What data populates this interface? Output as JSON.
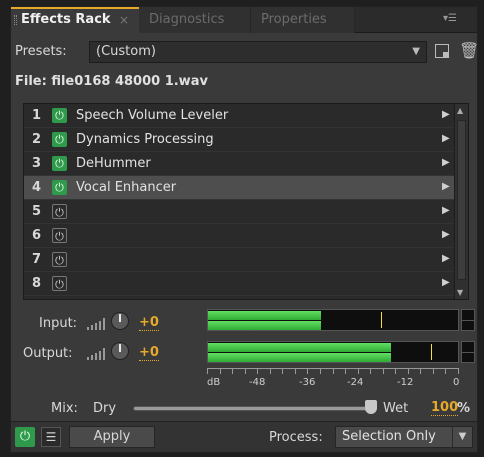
{
  "tabs": [
    {
      "label": "Effects Rack",
      "active": true,
      "close": "×"
    },
    {
      "label": "Diagnostics",
      "active": false
    },
    {
      "label": "Properties",
      "active": false
    }
  ],
  "presets": {
    "label": "Presets:",
    "value": "(Custom)"
  },
  "file": {
    "text": "File: file0168 48000 1.wav"
  },
  "effects": [
    {
      "num": "1",
      "name": "Speech Volume Leveler",
      "power": "on",
      "selected": false
    },
    {
      "num": "2",
      "name": "Dynamics Processing",
      "power": "on",
      "selected": false
    },
    {
      "num": "3",
      "name": "DeHummer",
      "power": "on",
      "selected": false
    },
    {
      "num": "4",
      "name": "Vocal Enhancer",
      "power": "on",
      "selected": true
    },
    {
      "num": "5",
      "name": "",
      "power": "off",
      "selected": false
    },
    {
      "num": "6",
      "name": "",
      "power": "off",
      "selected": false
    },
    {
      "num": "7",
      "name": "",
      "power": "off",
      "selected": false
    },
    {
      "num": "8",
      "name": "",
      "power": "off",
      "selected": false
    }
  ],
  "input": {
    "label": "Input:",
    "value": "+0",
    "level_fraction": 0.45,
    "peak_fraction": 0.69
  },
  "output": {
    "label": "Output:",
    "value": "+0",
    "level_fraction": 0.73,
    "peak_fraction": 0.89
  },
  "scale": {
    "labels": [
      "dB",
      "-48",
      "-36",
      "-24",
      "-12",
      "0"
    ]
  },
  "mix": {
    "label": "Mix:",
    "dry": "Dry",
    "wet": "Wet",
    "value": "100",
    "unit": "%"
  },
  "bottom": {
    "apply": "Apply",
    "process_label": "Process:",
    "process_value": "Selection Only"
  },
  "colors": {
    "accent": "#e6a92a",
    "power_on": "#2f9a4b",
    "meter": "#4cd04c"
  }
}
